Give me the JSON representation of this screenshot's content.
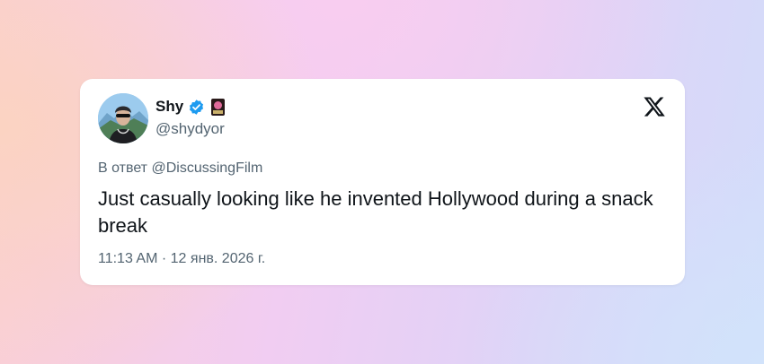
{
  "author": {
    "display_name": "Shy",
    "handle": "@shydyor",
    "verified_icon": "verified-badge-icon",
    "badge_icon": "emoji-badge-icon"
  },
  "reply": {
    "prefix": "В ответ",
    "mention": "@DiscussingFilm"
  },
  "tweet": {
    "text": "Just casually looking like he invented Hollywood during a snack break",
    "time": "11:13 AM",
    "separator": "·",
    "date": "12 янв. 2026 г."
  },
  "platform_logo": "x-logo-icon",
  "colors": {
    "verified": "#1d9bf0",
    "text_primary": "#0f1419",
    "text_secondary": "#536471",
    "card_bg": "#ffffff"
  }
}
